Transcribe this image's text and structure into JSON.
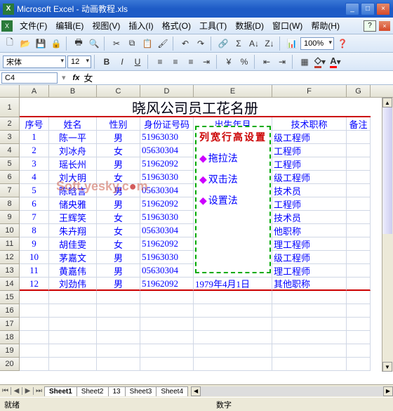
{
  "window": {
    "title": "Microsoft Excel - 动画教程.xls"
  },
  "menu": {
    "file": "文件(F)",
    "edit": "编辑(E)",
    "view": "视图(V)",
    "insert": "插入(I)",
    "format": "格式(O)",
    "tools": "工具(T)",
    "data": "数据(D)",
    "window": "窗口(W)",
    "help": "帮助(H)"
  },
  "toolbar": {
    "zoom": "100%"
  },
  "fmt": {
    "font": "宋体",
    "size": "12"
  },
  "namebox": {
    "ref": "C4",
    "fx": "fx",
    "value": "女"
  },
  "cols": [
    "A",
    "B",
    "C",
    "D",
    "E",
    "F",
    "G"
  ],
  "title": "晓风公司员工花名册",
  "headers": {
    "A": "序号",
    "B": "姓名",
    "C": "性别",
    "D": "身份证号码",
    "E": "出生年月",
    "F": "技术职称",
    "G": "备注"
  },
  "rows": [
    {
      "n": "1",
      "name": "陈一平",
      "sex": "男",
      "id": "51963030",
      "f": "级工程师"
    },
    {
      "n": "2",
      "name": "刘冰舟",
      "sex": "女",
      "id": "05630304",
      "f": "工程师"
    },
    {
      "n": "3",
      "name": "瑶长州",
      "sex": "男",
      "id": "51962092",
      "f": "工程师"
    },
    {
      "n": "4",
      "name": "刘大明",
      "sex": "女",
      "id": "51963030",
      "f": "级工程师"
    },
    {
      "n": "5",
      "name": "陈晗言",
      "sex": "男",
      "id": "05630304",
      "f": "技术员"
    },
    {
      "n": "6",
      "name": "储央雅",
      "sex": "男",
      "id": "51962092",
      "f": "工程师"
    },
    {
      "n": "7",
      "name": "王辉笑",
      "sex": "女",
      "id": "51963030",
      "f": "技术员"
    },
    {
      "n": "8",
      "name": "朱卉翔",
      "sex": "女",
      "id": "05630304",
      "f": "他职称"
    },
    {
      "n": "9",
      "name": "胡佳雯",
      "sex": "女",
      "id": "51962092",
      "f": "理工程师"
    },
    {
      "n": "10",
      "name": "茅嘉文",
      "sex": "男",
      "id": "51963030",
      "f": "级工程师"
    },
    {
      "n": "11",
      "name": "黄嘉伟",
      "sex": "男",
      "id": "05630304",
      "f": "理工程师"
    },
    {
      "n": "12",
      "name": "刘劲伟",
      "sex": "男",
      "id": "51962092",
      "e": "1979年4月1日",
      "f": "其他职称"
    }
  ],
  "overlay": {
    "title": "列宽行高设置",
    "i1": "拖拉法",
    "i2": "双击法",
    "i3": "设置法"
  },
  "watermark": {
    "t1": "Soft",
    "t2": "yesky",
    "t3": "c",
    "t4": "m"
  },
  "tabs": {
    "s1": "Sheet1",
    "s2": "Sheet2",
    "s13": "13",
    "s3": "Sheet3",
    "s4": "Sheet4"
  },
  "status": {
    "ready": "就绪",
    "num": "数字"
  }
}
